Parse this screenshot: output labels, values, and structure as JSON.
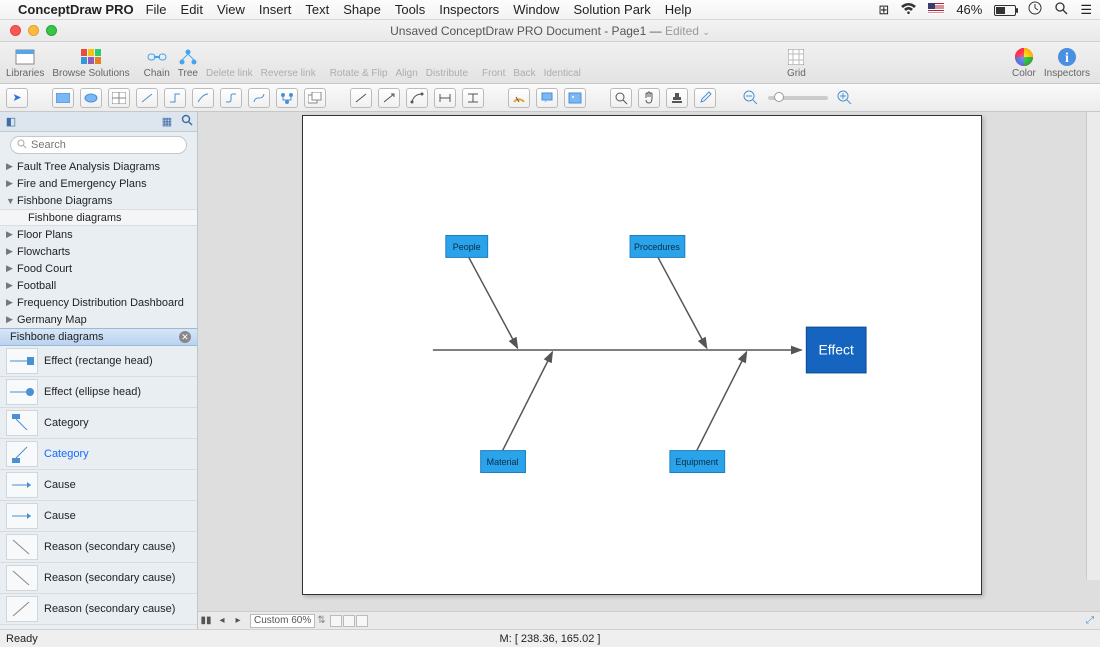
{
  "menubar": {
    "apple": "",
    "app": "ConceptDraw PRO",
    "items": [
      "File",
      "Edit",
      "View",
      "Insert",
      "Text",
      "Shape",
      "Tools",
      "Inspectors",
      "Window",
      "Solution Park",
      "Help"
    ],
    "battery_pct": "46%"
  },
  "window": {
    "title_prefix": "Unsaved ConceptDraw PRO Document - Page1 — ",
    "title_edited": "Edited"
  },
  "toolbar1": {
    "libraries": "Libraries",
    "browse": "Browse Solutions",
    "chain": "Chain",
    "tree": "Tree",
    "delete_link": "Delete link",
    "reverse_link": "Reverse link",
    "rotate_flip": "Rotate & Flip",
    "align": "Align",
    "distribute": "Distribute",
    "front": "Front",
    "back": "Back",
    "identical": "Identical",
    "grid": "Grid",
    "color": "Color",
    "inspectors": "Inspectors"
  },
  "sidebar": {
    "search_placeholder": "Search",
    "categories": [
      {
        "label": "Fault Tree Analysis Diagrams",
        "state": "collapsed"
      },
      {
        "label": "Fire and Emergency Plans",
        "state": "collapsed"
      },
      {
        "label": "Fishbone Diagrams",
        "state": "expanded",
        "children": [
          "Fishbone diagrams"
        ]
      },
      {
        "label": "Floor Plans",
        "state": "collapsed"
      },
      {
        "label": "Flowcharts",
        "state": "collapsed"
      },
      {
        "label": "Food Court",
        "state": "collapsed"
      },
      {
        "label": "Football",
        "state": "collapsed"
      },
      {
        "label": "Frequency Distribution Dashboard",
        "state": "collapsed"
      },
      {
        "label": "Germany Map",
        "state": "collapsed"
      }
    ],
    "library_header": "Fishbone diagrams",
    "shapes": [
      {
        "name": "Effect (rectange head)",
        "selected": false
      },
      {
        "name": "Effect (ellipse head)",
        "selected": false
      },
      {
        "name": "Category",
        "selected": false
      },
      {
        "name": "Category",
        "selected": true
      },
      {
        "name": "Cause",
        "selected": false
      },
      {
        "name": "Cause",
        "selected": false
      },
      {
        "name": "Reason (secondary cause)",
        "selected": false
      },
      {
        "name": "Reason (secondary cause)",
        "selected": false
      },
      {
        "name": "Reason (secondary cause)",
        "selected": false
      }
    ]
  },
  "diagram": {
    "effect_label": "Effect",
    "categories_top": [
      "People",
      "Procedures"
    ],
    "categories_bottom": [
      "Material",
      "Equipment"
    ]
  },
  "bottom": {
    "zoom_label": "Custom 60%"
  },
  "status": {
    "ready": "Ready",
    "mouse": "M: [ 238.36, 165.02 ]"
  }
}
